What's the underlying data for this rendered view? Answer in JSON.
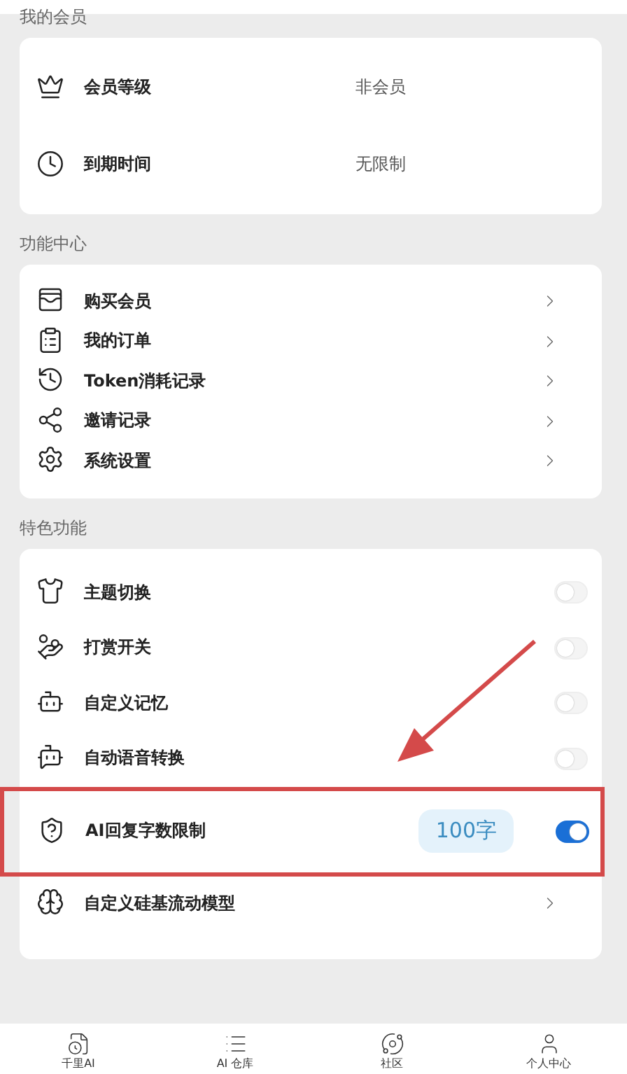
{
  "membership": {
    "title": "我的会员",
    "rows": [
      {
        "label": "会员等级",
        "value": "非会员"
      },
      {
        "label": "到期时间",
        "value": "无限制"
      }
    ]
  },
  "functions": {
    "title": "功能中心",
    "items": [
      {
        "label": "购买会员"
      },
      {
        "label": "我的订单"
      },
      {
        "label": "Token消耗记录"
      },
      {
        "label": "邀请记录"
      },
      {
        "label": "系统设置"
      }
    ]
  },
  "special": {
    "title": "特色功能",
    "items": [
      {
        "kind": "switch",
        "label": "主题切换",
        "on": false
      },
      {
        "kind": "switch",
        "label": "打赏开关",
        "on": false
      },
      {
        "kind": "switch",
        "label": "自定义记忆",
        "on": false
      },
      {
        "kind": "switch",
        "label": "自动语音转换",
        "on": false
      },
      {
        "kind": "switch",
        "label": "AI回复字数限制",
        "on": true,
        "badge": "100字",
        "highlighted": true
      },
      {
        "kind": "link",
        "label": "自定义硅基流动模型"
      }
    ]
  },
  "tab_bar": [
    {
      "label": "千里AI"
    },
    {
      "label": "AI 仓库"
    },
    {
      "label": "社区"
    },
    {
      "label": "个人中心"
    }
  ]
}
